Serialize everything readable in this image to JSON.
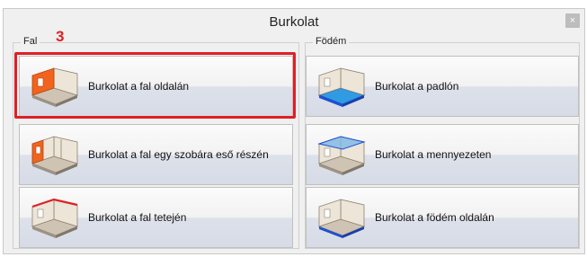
{
  "window": {
    "title": "Burkolat",
    "close_symbol": "×"
  },
  "annotation": {
    "step_number": "3",
    "color": "#e01e25"
  },
  "groups": {
    "fal": {
      "label": "Fal",
      "items": [
        {
          "label": "Burkolat a fal oldalán",
          "icon": "wall-side-cladding-icon"
        },
        {
          "label": "Burkolat a fal egy szobára eső részén",
          "icon": "wall-room-part-cladding-icon"
        },
        {
          "label": "Burkolat a fal tetején",
          "icon": "wall-top-cladding-icon"
        }
      ]
    },
    "fodem": {
      "label": "Födém",
      "items": [
        {
          "label": "Burkolat a padlón",
          "icon": "floor-cladding-icon"
        },
        {
          "label": "Burkolat a mennyezeten",
          "icon": "ceiling-cladding-icon"
        },
        {
          "label": "Burkolat a födém oldalán",
          "icon": "slab-side-cladding-icon"
        }
      ]
    }
  },
  "colors": {
    "wall_highlight": "#f0641e",
    "slab_highlight": "#1f4fd1",
    "floor_fill": "#2f9be3"
  }
}
